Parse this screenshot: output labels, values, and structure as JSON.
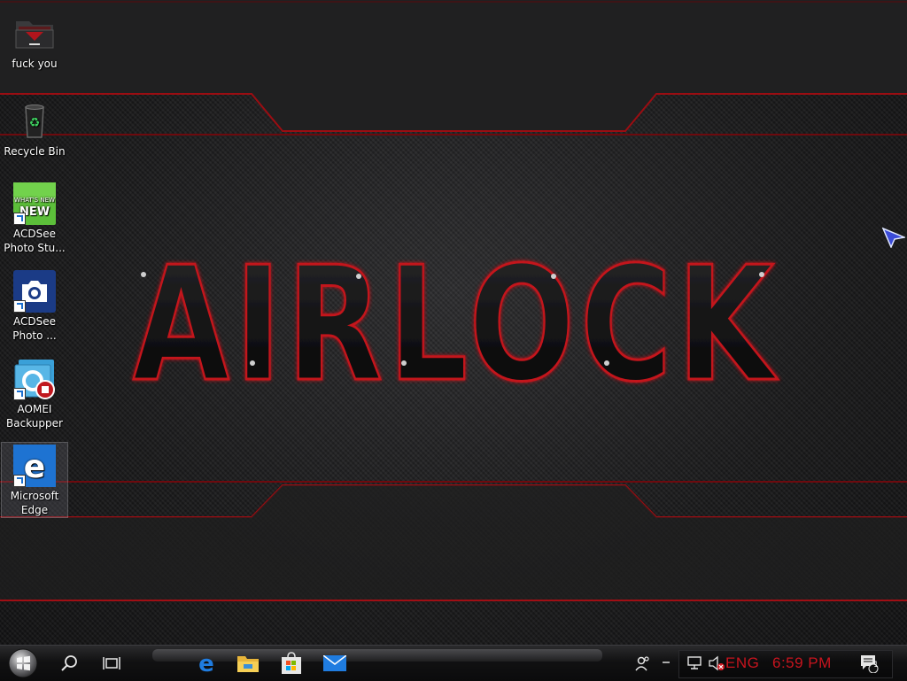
{
  "desktop": {
    "wallpaper_text": "AIRLOCK",
    "icons": [
      {
        "label": "fuck you",
        "icon": "folder-icon"
      },
      {
        "label": "Recycle Bin",
        "icon": "recycle-bin-icon"
      },
      {
        "label": "ACDSee Photo Stu...",
        "icon": "acdsee-whats-new-icon",
        "badge": "WHAT'S NEW"
      },
      {
        "label": "ACDSee Photo ...",
        "icon": "acdsee-camera-icon"
      },
      {
        "label": "AOMEI Backupper",
        "icon": "aomei-backupper-icon"
      },
      {
        "label": "Microsoft Edge",
        "icon": "edge-icon"
      }
    ]
  },
  "taskbar": {
    "start": {
      "icon": "start-orb-icon"
    },
    "search": {
      "icon": "search-icon"
    },
    "task_view": {
      "icon": "task-view-icon"
    },
    "pinned": [
      {
        "name": "Microsoft Edge",
        "icon": "edge-icon"
      },
      {
        "name": "File Explorer",
        "icon": "file-explorer-icon"
      },
      {
        "name": "Microsoft Store",
        "icon": "store-icon"
      },
      {
        "name": "Mail",
        "icon": "mail-icon"
      }
    ],
    "tray": {
      "people_icon": "people-icon",
      "network_icon": "network-icon",
      "volume_icon": "volume-muted-icon",
      "language": "ENG",
      "time": "6:59 PM",
      "notifications_count": "1",
      "notifications_icon": "action-center-icon"
    }
  },
  "colors": {
    "accent_red": "#c8141e",
    "taskbar_bg": "#111112",
    "desktop_bg": "#1c1c1d"
  }
}
